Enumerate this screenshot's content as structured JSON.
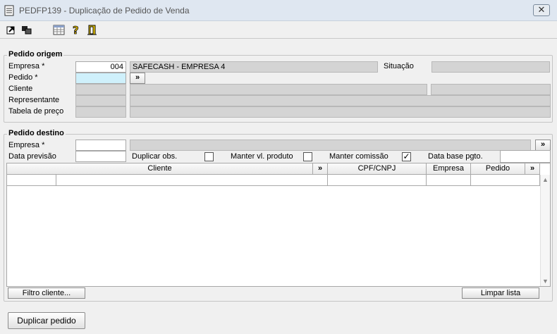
{
  "window": {
    "title": "PEDFP139 - Duplicação de Pedido de Venda",
    "close_label": "✕"
  },
  "toolbar": {
    "icons": [
      "export-icon",
      "copy-window-icon",
      "calendar-grid-icon",
      "help-icon",
      "exit-door-icon"
    ]
  },
  "origem": {
    "title": "Pedido origem",
    "empresa_label": "Empresa *",
    "empresa_value": "004",
    "empresa_name": "SAFECASH -  EMPRESA 4",
    "situacao_label": "Situação",
    "situacao_value": "",
    "pedido_label": "Pedido *",
    "pedido_value": "",
    "pedido_btn": "»",
    "cliente_label": "Cliente",
    "representante_label": "Representante",
    "tabela_label": "Tabela de preço"
  },
  "destino": {
    "title": "Pedido destino",
    "empresa_label": "Empresa *",
    "empresa_value": "",
    "empresa_btn": "»",
    "data_previsao_label": "Data previsão",
    "data_previsao_value": "",
    "duplicar_obs_label": "Duplicar obs.",
    "duplicar_obs_checked": false,
    "manter_vl_label": "Manter vl. produto",
    "manter_vl_checked": false,
    "manter_comissao_label": "Manter comissão",
    "manter_comissao_checked": true,
    "data_base_label": "Data base pgto.",
    "data_base_value": ""
  },
  "grid": {
    "columns": {
      "cliente": "Cliente",
      "cliente_btn": "»",
      "cpf": "CPF/CNPJ",
      "empresa": "Empresa",
      "pedido": "Pedido",
      "pedido_btn": "»"
    },
    "rows": []
  },
  "buttons": {
    "filtro_cliente": "Filtro cliente...",
    "limpar_lista": "Limpar lista",
    "duplicar_pedido": "Duplicar pedido"
  }
}
